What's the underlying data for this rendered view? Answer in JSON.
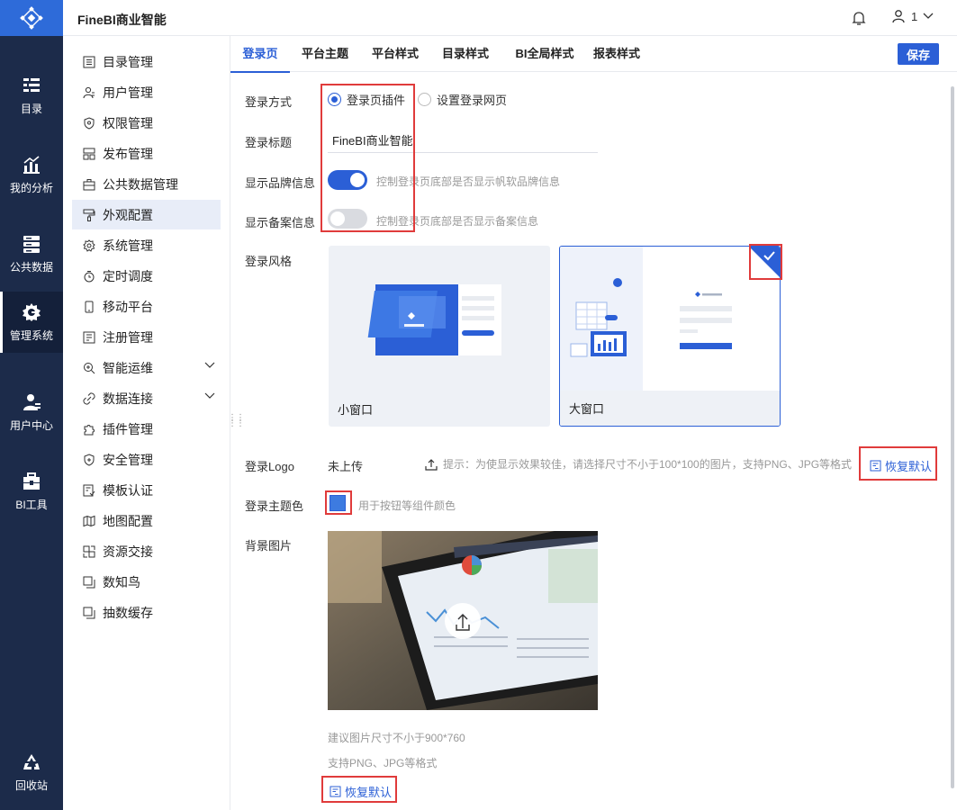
{
  "app": {
    "title": "FineBI商业智能"
  },
  "header": {
    "user_label": "1"
  },
  "rail": {
    "items": [
      {
        "label": "目录",
        "icon": "catalog-icon"
      },
      {
        "label": "我的分析",
        "icon": "analysis-icon"
      },
      {
        "label": "公共数据",
        "icon": "database-icon"
      },
      {
        "label": "管理系统",
        "icon": "gear-icon"
      },
      {
        "label": "用户中心",
        "icon": "user-icon"
      },
      {
        "label": "BI工具",
        "icon": "toolbox-icon"
      }
    ],
    "bottom": {
      "label": "回收站",
      "icon": "recycle-icon"
    }
  },
  "sidebar": {
    "items": [
      {
        "label": "目录管理"
      },
      {
        "label": "用户管理"
      },
      {
        "label": "权限管理"
      },
      {
        "label": "发布管理"
      },
      {
        "label": "公共数据管理"
      },
      {
        "label": "外观配置"
      },
      {
        "label": "系统管理"
      },
      {
        "label": "定时调度"
      },
      {
        "label": "移动平台"
      },
      {
        "label": "注册管理"
      },
      {
        "label": "智能运维"
      },
      {
        "label": "数据连接"
      },
      {
        "label": "插件管理"
      },
      {
        "label": "安全管理"
      },
      {
        "label": "模板认证"
      },
      {
        "label": "地图配置"
      },
      {
        "label": "资源交接"
      },
      {
        "label": "数知鸟"
      },
      {
        "label": "抽数缓存"
      }
    ]
  },
  "tabs": [
    {
      "label": "登录页"
    },
    {
      "label": "平台主题"
    },
    {
      "label": "平台样式"
    },
    {
      "label": "目录样式"
    },
    {
      "label": "BI全局样式"
    },
    {
      "label": "报表样式"
    }
  ],
  "toolbar": {
    "save_label": "保存"
  },
  "form": {
    "login_method": {
      "label": "登录方式",
      "option_plugin": "登录页插件",
      "option_web": "设置登录网页"
    },
    "login_title": {
      "label": "登录标题",
      "value": "FineBI商业智能"
    },
    "brand": {
      "label": "显示品牌信息",
      "hint": "控制登录页底部是否显示帆软品牌信息"
    },
    "record": {
      "label": "显示备案信息",
      "hint": "控制登录页底部是否显示备案信息"
    },
    "style": {
      "label": "登录风格",
      "small": "小窗口",
      "large": "大窗口"
    },
    "logo": {
      "label": "登录Logo",
      "status": "未上传",
      "tip": "提示：为使显示效果较佳，请选择尺寸不小于100*100的图片，支持PNG、JPG等格式",
      "restore": "恢复默认"
    },
    "theme_color": {
      "label": "登录主题色",
      "hint": "用于按钮等组件颜色",
      "color": "#3d7be0"
    },
    "background": {
      "label": "背景图片",
      "tip1": "建议图片尺寸不小于900*760",
      "tip2": "支持PNG、JPG等格式",
      "restore": "恢复默认"
    }
  }
}
